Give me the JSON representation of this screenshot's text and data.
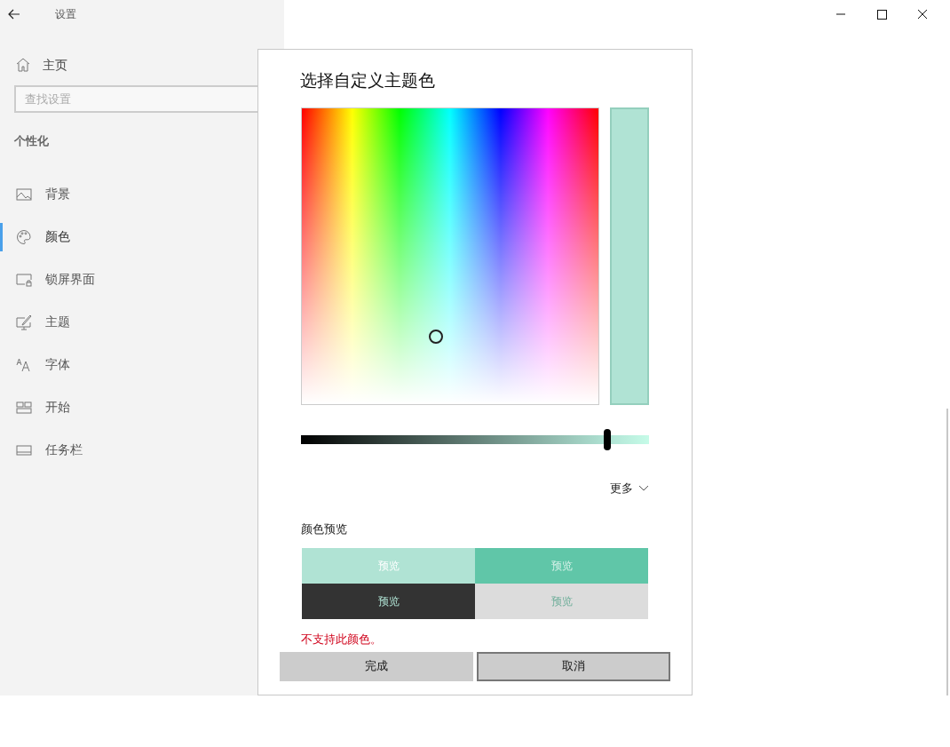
{
  "window": {
    "title": "设置"
  },
  "sidebar": {
    "home": "主页",
    "search": {
      "placeholder": "查找设置"
    },
    "section": "个性化",
    "items": [
      {
        "label": "背景",
        "selected": false
      },
      {
        "label": "颜色",
        "selected": true
      },
      {
        "label": "锁屏界面",
        "selected": false
      },
      {
        "label": "主题",
        "selected": false
      },
      {
        "label": "字体",
        "selected": false
      },
      {
        "label": "开始",
        "selected": false
      },
      {
        "label": "任务栏",
        "selected": false
      }
    ]
  },
  "dialog": {
    "title": "选择自定义主题色",
    "brightness": {
      "level": 0.88
    },
    "more": "更多",
    "preview_title": "颜色预览",
    "previews": [
      {
        "label": "预览",
        "color": "#b0e3d4"
      },
      {
        "label": "预览",
        "color": "#60c6a8"
      },
      {
        "label": "预览",
        "color": "#333333"
      },
      {
        "label": "预览",
        "color": "#dcdcdc"
      }
    ],
    "error": "不支持此颜色。",
    "buttons": [
      {
        "label": "完成",
        "focused": false
      },
      {
        "label": "取消",
        "focused": true
      }
    ]
  }
}
